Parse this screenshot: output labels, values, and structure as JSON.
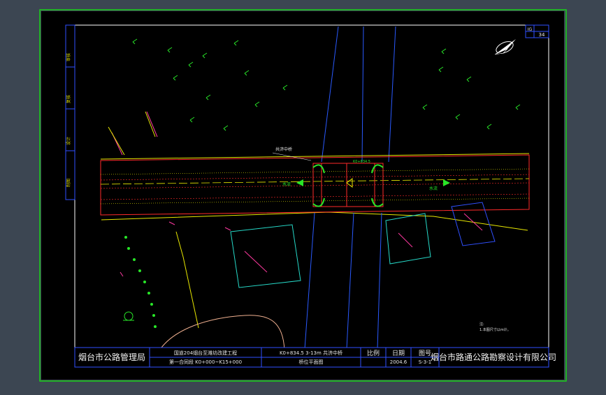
{
  "sheet": {
    "page_number": "34",
    "page_marker": "IG"
  },
  "side_strip": {
    "cells": [
      "审核",
      "复核",
      "设计",
      "制图"
    ]
  },
  "title_block": {
    "client": "烟台市公路管理局",
    "project_line1": "国道204烟台至潍坊改建工程",
    "project_line2": "第一合同段  K0+000~K15+000",
    "drawing_line1": "K0+834.5  3-13m  共济中桥",
    "drawing_line2": "桥位平面图",
    "scale_label": "比例",
    "date_label": "日期",
    "date_value": "2004.6",
    "drawing_no_label": "图号",
    "drawing_no_value": "S-3-1",
    "designer": "烟台市路通公路勘察设计有限公司"
  },
  "annotations": {
    "bridge_name": "共济中桥",
    "station_label": "K0+834.5",
    "flow_label_left": "水流",
    "flow_label_right": "水流",
    "note_line1": "注:",
    "note_line2": "1.本图尺寸以m计。"
  },
  "colors": {
    "background": "#3c4652",
    "frame_green": "#19d219",
    "title_blue": "#3050ff",
    "road_edge": "#ff2a2a",
    "road_yellow": "#e8e800",
    "river_blue": "#2a5aff",
    "magenta": "#ff3aa0",
    "cyan": "#26d9c8",
    "vegetation": "#28e628"
  }
}
